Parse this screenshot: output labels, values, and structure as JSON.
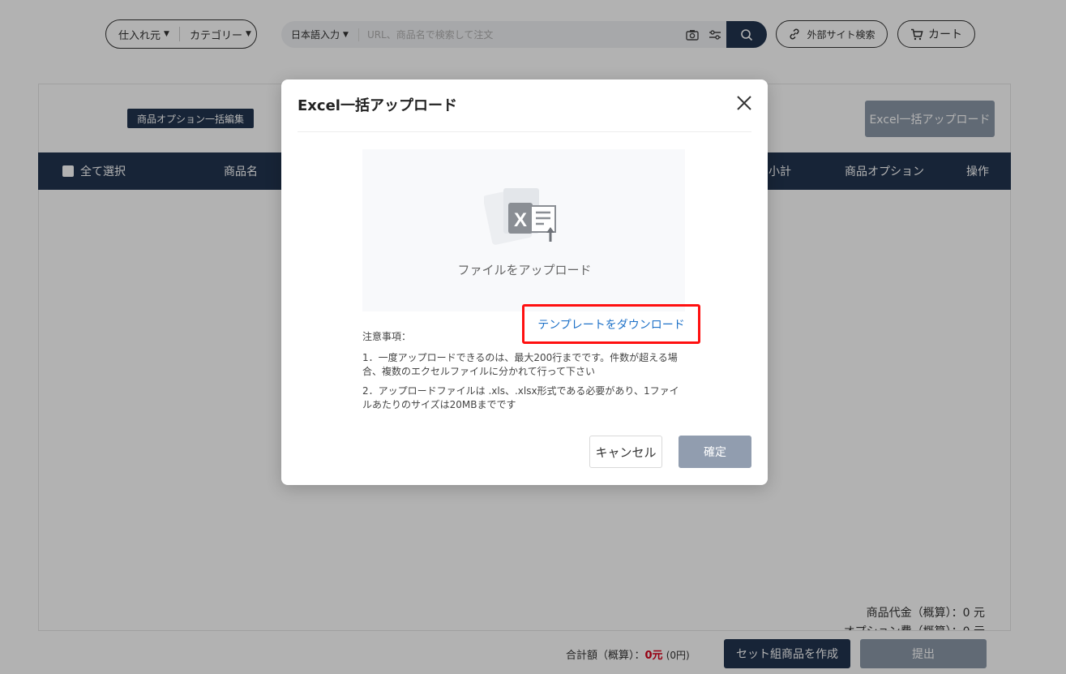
{
  "header": {
    "supplier_label": "仕入れ元",
    "category_label": "カテゴリー",
    "input_lang_label": "日本語入力",
    "search_placeholder": "URL、商品名で検索して注文",
    "external_search_label": "外部サイト検索",
    "cart_label": "カート"
  },
  "panel": {
    "option_bulk_edit_label": "商品オプション一括編集",
    "excel_upload_button_label": "Excel一括アップロード",
    "table_columns": [
      "全て選択",
      "商品名",
      "小計",
      "商品オプション",
      "操作"
    ],
    "summary": {
      "product_price": "商品代金（概算）：0 元",
      "option_fee": "オプション費（概算）：0 元"
    },
    "footer": {
      "total_label": "合計額（概算）：",
      "total_value": "0元",
      "total_jpy": "(0円)",
      "create_set_label": "セット組商品を作成",
      "submit_label": "提出"
    }
  },
  "modal": {
    "title": "Excel一括アップロード",
    "upload_label": "ファイルをアップロード",
    "template_link": "テンプレートをダウンロード",
    "notes_title": "注意事項：",
    "notes": [
      "1．一度アップロードできるのは、最大200行までです。件数が超える場合、複数のエクセルファイルに分かれて行って下さい",
      "2．アップロードファイルは .xls、.xlsx形式である必要があり、1ファイルあたりのサイズは20MBまでです"
    ],
    "cancel_label": "キャンセル",
    "confirm_label": "確定"
  },
  "colors": {
    "navy": "#22344f",
    "disabled": "#8b98a8",
    "link": "#1f72c8",
    "highlight": "#ff1010",
    "price_red": "#d9001b"
  }
}
